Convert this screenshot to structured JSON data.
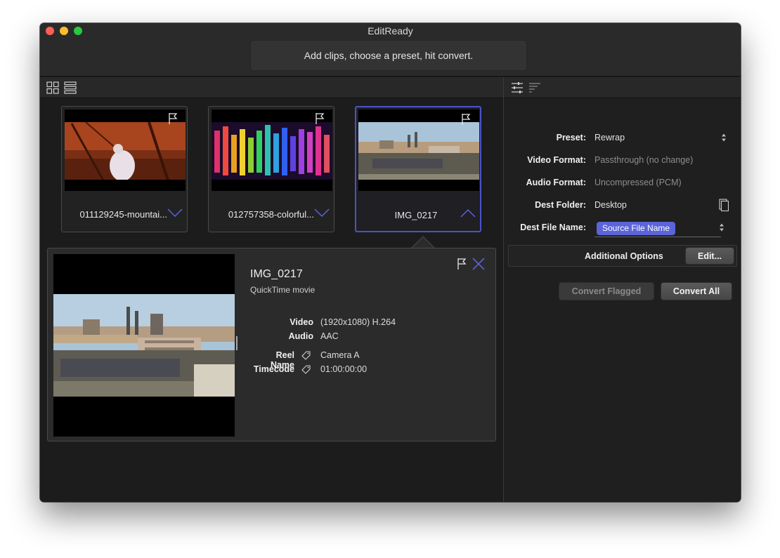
{
  "window": {
    "title": "EditReady",
    "hint": "Add clips, choose a preset, hit convert."
  },
  "toolbar_left": {
    "icons": [
      "grid-view-icon",
      "list-view-icon"
    ]
  },
  "toolbar_right": {
    "icons": [
      "settings-sliders-icon",
      "sort-lines-icon"
    ]
  },
  "clips": [
    {
      "name": "011129245-mountai...",
      "selected": false
    },
    {
      "name": "012757358-colorful...",
      "selected": false
    },
    {
      "name": "IMG_0217",
      "selected": true
    }
  ],
  "detail": {
    "title": "IMG_0217",
    "subtitle": "QuickTime movie",
    "rows": [
      {
        "key": "Video",
        "value": "(1920x1080) H.264"
      },
      {
        "key": "Audio",
        "value": "AAC"
      },
      {
        "key": "Reel Name",
        "value": "Camera A"
      },
      {
        "key": "Timecode",
        "value": "01:00:00:00"
      }
    ]
  },
  "settings": {
    "preset": {
      "label": "Preset:",
      "value": "Rewrap"
    },
    "video_format": {
      "label": "Video Format:",
      "value": "Passthrough (no change)"
    },
    "audio_format": {
      "label": "Audio Format:",
      "value": "Uncompressed (PCM)"
    },
    "dest_folder": {
      "label": "Dest Folder:",
      "value": "Desktop"
    },
    "dest_file_name": {
      "label": "Dest File Name:",
      "token": "Source File Name"
    },
    "additional_options": {
      "label": "Additional Options",
      "button": "Edit..."
    }
  },
  "actions": {
    "convert_flagged": "Convert Flagged",
    "convert_all": "Convert All"
  },
  "colors": {
    "accent": "#5b64d8",
    "selection_border": "#4b52c9",
    "window_bg": "#1e1e1e"
  }
}
